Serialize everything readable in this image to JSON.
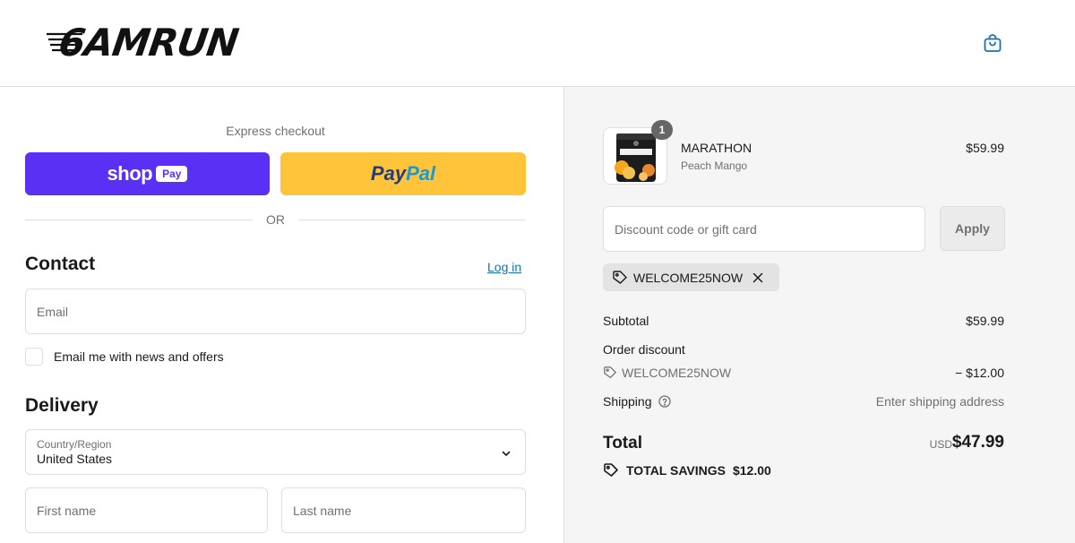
{
  "header": {
    "logo_text": "6AMRUN",
    "cart_icon": "shopping-bag-icon"
  },
  "express": {
    "label": "Express checkout",
    "shop_pay": {
      "text": "shop",
      "badge": "Pay"
    },
    "paypal": {
      "part1": "Pay",
      "part2": "Pal"
    },
    "or_label": "OR"
  },
  "contact": {
    "title": "Contact",
    "login_label": "Log in",
    "email_placeholder": "Email",
    "newsletter_label": "Email me with news and offers"
  },
  "delivery": {
    "title": "Delivery",
    "country_label": "Country/Region",
    "country_value": "United States",
    "first_name_placeholder": "First name",
    "last_name_placeholder": "Last name"
  },
  "order": {
    "product": {
      "name": "MARATHON",
      "variant": "Peach Mango",
      "price": "$59.99",
      "quantity": "1"
    },
    "discount_placeholder": "Discount code or gift card",
    "apply_label": "Apply",
    "applied_code": "WELCOME25NOW",
    "subtotal_label": "Subtotal",
    "subtotal_value": "$59.99",
    "order_discount_label": "Order discount",
    "discount_code": "WELCOME25NOW",
    "discount_value": "− $12.00",
    "shipping_label": "Shipping",
    "shipping_value": "Enter shipping address",
    "total_label": "Total",
    "currency": "USD",
    "total_value": "$47.99",
    "savings_label": "TOTAL SAVINGS",
    "savings_value": "$12.00"
  },
  "colors": {
    "shop_pay": "#5a31f4",
    "paypal": "#ffc439",
    "link": "#1773b0",
    "summary_bg": "#f5f5f5"
  }
}
